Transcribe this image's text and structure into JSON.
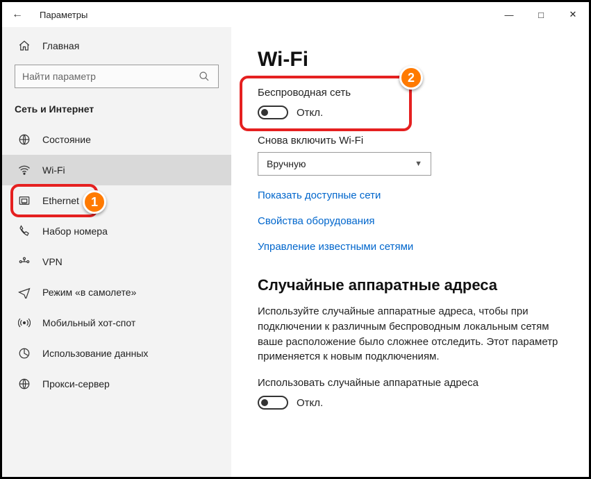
{
  "window": {
    "title": "Параметры"
  },
  "sidebar": {
    "home": "Главная",
    "search_placeholder": "Найти параметр",
    "group": "Сеть и Интернет",
    "items": [
      {
        "label": "Состояние"
      },
      {
        "label": "Wi-Fi"
      },
      {
        "label": "Ethernet"
      },
      {
        "label": "Набор номера"
      },
      {
        "label": "VPN"
      },
      {
        "label": "Режим «в самолете»"
      },
      {
        "label": "Мобильный хот-спот"
      },
      {
        "label": "Использование данных"
      },
      {
        "label": "Прокси-сервер"
      }
    ]
  },
  "main": {
    "heading": "Wi-Fi",
    "wireless_label": "Беспроводная сеть",
    "wireless_state": "Откл.",
    "reenable_label": "Снова включить Wi-Fi",
    "reenable_value": "Вручную",
    "link_available": "Показать доступные сети",
    "link_hw": "Свойства оборудования",
    "link_known": "Управление известными сетями",
    "rand_heading": "Случайные аппаратные адреса",
    "rand_para": "Используйте случайные аппаратные адреса, чтобы при подключении к различным беспроводным локальным сетям ваше расположение было сложнее отследить. Этот параметр применяется к новым подключениям.",
    "rand_toggle_label": "Использовать случайные аппаратные адреса",
    "rand_toggle_state": "Откл."
  },
  "callouts": {
    "one": "1",
    "two": "2"
  }
}
